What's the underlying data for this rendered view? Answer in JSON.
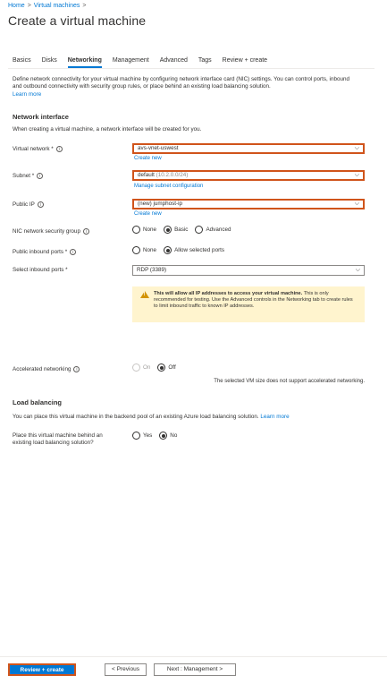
{
  "breadcrumb": {
    "home": "Home",
    "sep": ">",
    "parent": "Virtual machines",
    "sep2": ">"
  },
  "page_title": "Create a virtual machine",
  "tabs": [
    {
      "label": "Basics"
    },
    {
      "label": "Disks"
    },
    {
      "label": "Networking"
    },
    {
      "label": "Management"
    },
    {
      "label": "Advanced"
    },
    {
      "label": "Tags"
    },
    {
      "label": "Review + create"
    }
  ],
  "active_tab": "Networking",
  "description": "Define network connectivity for your virtual machine by configuring network interface card (NIC) settings. You can control ports, inbound and outbound connectivity with security group rules, or place behind an existing load balancing solution.",
  "learn_more": "Learn more",
  "network_interface": {
    "heading": "Network interface",
    "note": "When creating a virtual machine, a network interface will be created for you.",
    "vnet_label": "Virtual network *",
    "vnet_value": "avs-vnet-uswest",
    "vnet_create": "Create new",
    "subnet_label": "Subnet *",
    "subnet_value": "default",
    "subnet_range": "(10.2.0.0/24)",
    "subnet_manage": "Manage subnet configuration",
    "pip_label": "Public IP",
    "pip_value": "(new) jumphost-ip",
    "pip_create": "Create new",
    "nsg_label": "NIC network security group",
    "nsg_options": [
      "None",
      "Basic",
      "Advanced"
    ],
    "nsg_selected": "Basic",
    "inbound_label": "Public inbound ports *",
    "inbound_options": [
      "None",
      "Allow selected ports"
    ],
    "inbound_selected": "Allow selected ports",
    "ports_label": "Select inbound ports *",
    "ports_value": "RDP (3389)",
    "warning_bold": "This will allow all IP addresses to access your virtual machine.",
    "warning_text": "This is only recommended for testing. Use the Advanced controls in the Networking tab to create rules to limit inbound traffic to known IP addresses.",
    "accel_label": "Accelerated networking",
    "accel_options": [
      "On",
      "Off"
    ],
    "accel_selected": "Off",
    "accel_note": "The selected VM size does not support accelerated networking."
  },
  "load_balancing": {
    "heading": "Load balancing",
    "note": "You can place this virtual machine in the backend pool of an existing Azure load balancing solution.",
    "learn_more": "Learn more",
    "question_line1": "Place this virtual machine behind an",
    "question_line2": "existing load balancing solution?",
    "options": [
      "Yes",
      "No"
    ],
    "selected": "No"
  },
  "footer": {
    "review_create": "Review + create",
    "previous": "< Previous",
    "next": "Next : Management >"
  },
  "colors": {
    "accent": "#0078d4",
    "highlight": "#d0541b",
    "warning_bg": "#fff4ce"
  }
}
